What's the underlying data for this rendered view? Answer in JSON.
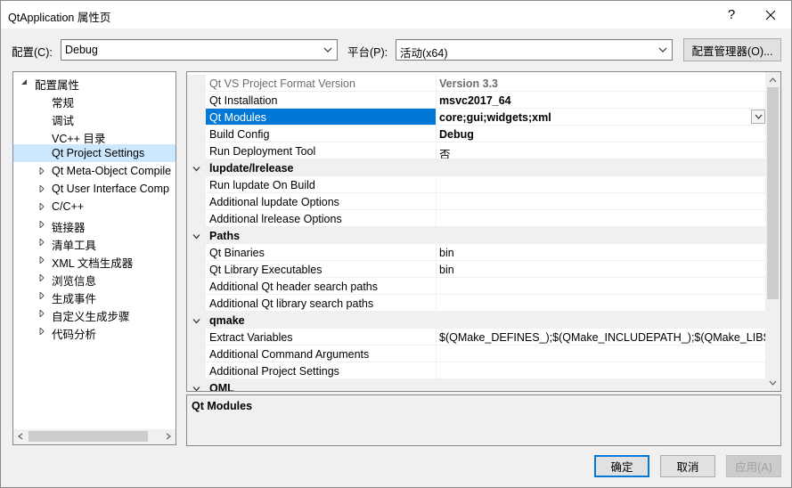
{
  "window": {
    "title": "QtApplication 属性页",
    "help": "?"
  },
  "toolbar": {
    "config_label": "配置(C):",
    "config_value": "Debug",
    "platform_label": "平台(P):",
    "platform_value": "活动(x64)",
    "config_manager": "配置管理器(O)..."
  },
  "tree": {
    "root": "配置属性",
    "items": [
      "常规",
      "调试",
      "VC++ 目录",
      "Qt Project Settings",
      "Qt Meta-Object Compile",
      "Qt User Interface Comp",
      "C/C++",
      "链接器",
      "清单工具",
      "XML 文档生成器",
      "浏览信息",
      "生成事件",
      "自定义生成步骤",
      "代码分析"
    ]
  },
  "grid": {
    "rows": [
      {
        "name": "Qt VS Project Format Version",
        "value": "Version 3.3"
      },
      {
        "name": "Qt Installation",
        "value": "msvc2017_64"
      },
      {
        "name": "Qt Modules",
        "value": "core;gui;widgets;xml"
      },
      {
        "name": "Build Config",
        "value": "Debug"
      },
      {
        "name": "Run Deployment Tool",
        "value": "否"
      }
    ],
    "cat_lupdate": "lupdate/lrelease",
    "lupdate_rows": [
      {
        "name": "Run lupdate On Build",
        "value": ""
      },
      {
        "name": "Additional lupdate Options",
        "value": ""
      },
      {
        "name": "Additional lrelease Options",
        "value": ""
      }
    ],
    "cat_paths": "Paths",
    "paths_rows": [
      {
        "name": "Qt Binaries",
        "value": "bin"
      },
      {
        "name": "Qt Library Executables",
        "value": "bin"
      },
      {
        "name": "Additional Qt header search paths",
        "value": ""
      },
      {
        "name": "Additional Qt library search paths",
        "value": ""
      }
    ],
    "cat_qmake": "qmake",
    "qmake_rows": [
      {
        "name": "Extract Variables",
        "value": "$(QMake_DEFINES_);$(QMake_INCLUDEPATH_);$(QMake_LIBS_)"
      },
      {
        "name": "Additional Command Arguments",
        "value": ""
      },
      {
        "name": "Additional Project Settings",
        "value": ""
      }
    ],
    "cat_qml": "QML"
  },
  "description": {
    "title": "Qt Modules"
  },
  "buttons": {
    "ok": "确定",
    "cancel": "取消",
    "apply": "应用(A)"
  }
}
